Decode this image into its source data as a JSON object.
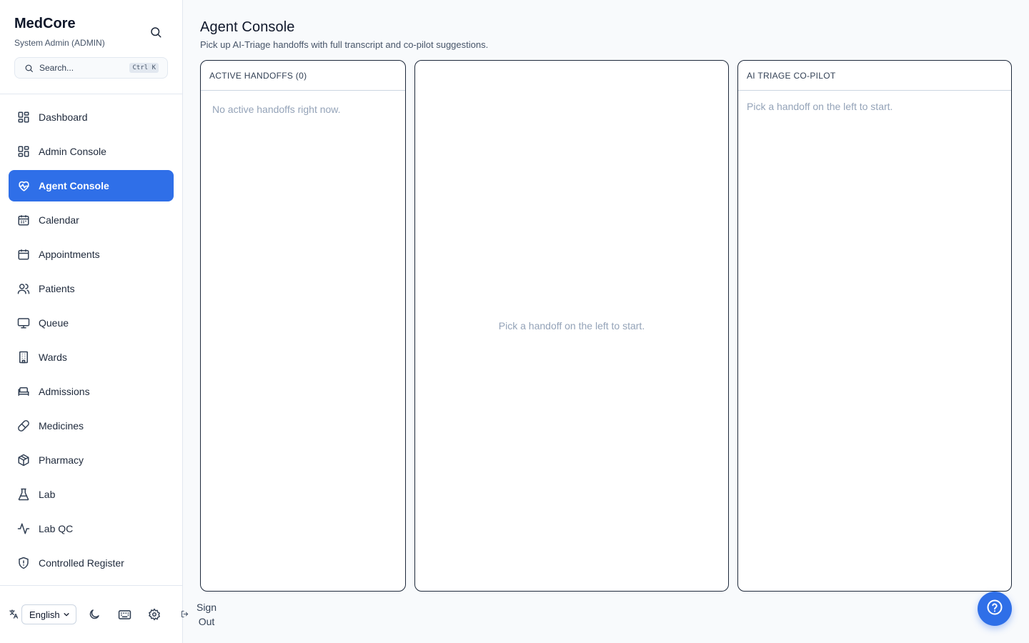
{
  "sidebar": {
    "brand": "MedCore",
    "role": "System Admin (ADMIN)",
    "search": {
      "label": "Search...",
      "shortcut": "Ctrl K"
    },
    "items": [
      {
        "label": "Dashboard",
        "icon": "dashboard-icon"
      },
      {
        "label": "Admin Console",
        "icon": "dashboard-icon"
      },
      {
        "label": "Agent Console",
        "icon": "heart-pulse-icon",
        "active": true
      },
      {
        "label": "Calendar",
        "icon": "calendar-grid-icon"
      },
      {
        "label": "Appointments",
        "icon": "calendar-icon"
      },
      {
        "label": "Patients",
        "icon": "users-icon"
      },
      {
        "label": "Queue",
        "icon": "monitor-icon"
      },
      {
        "label": "Wards",
        "icon": "building-icon"
      },
      {
        "label": "Admissions",
        "icon": "bed-icon"
      },
      {
        "label": "Medicines",
        "icon": "pill-icon"
      },
      {
        "label": "Pharmacy",
        "icon": "package-icon"
      },
      {
        "label": "Lab",
        "icon": "flask-icon"
      },
      {
        "label": "Lab QC",
        "icon": "activity-icon"
      },
      {
        "label": "Controlled Register",
        "icon": "shield-icon"
      }
    ],
    "footer": {
      "language": "English",
      "sign_out": "Sign Out"
    }
  },
  "main": {
    "title": "Agent Console",
    "subtitle": "Pick up AI-Triage handoffs with full transcript and co-pilot suggestions.",
    "handoffs": {
      "header": "ACTIVE HANDOFFS (0)",
      "empty": "No active handoffs right now."
    },
    "center": {
      "empty": "Pick a handoff on the left to start."
    },
    "copilot": {
      "header": "AI TRIAGE CO-PILOT",
      "empty": "Pick a handoff on the left to start."
    }
  },
  "colors": {
    "accent": "#2f6fe8",
    "border": "#1e293b",
    "muted": "#94a3b8"
  }
}
